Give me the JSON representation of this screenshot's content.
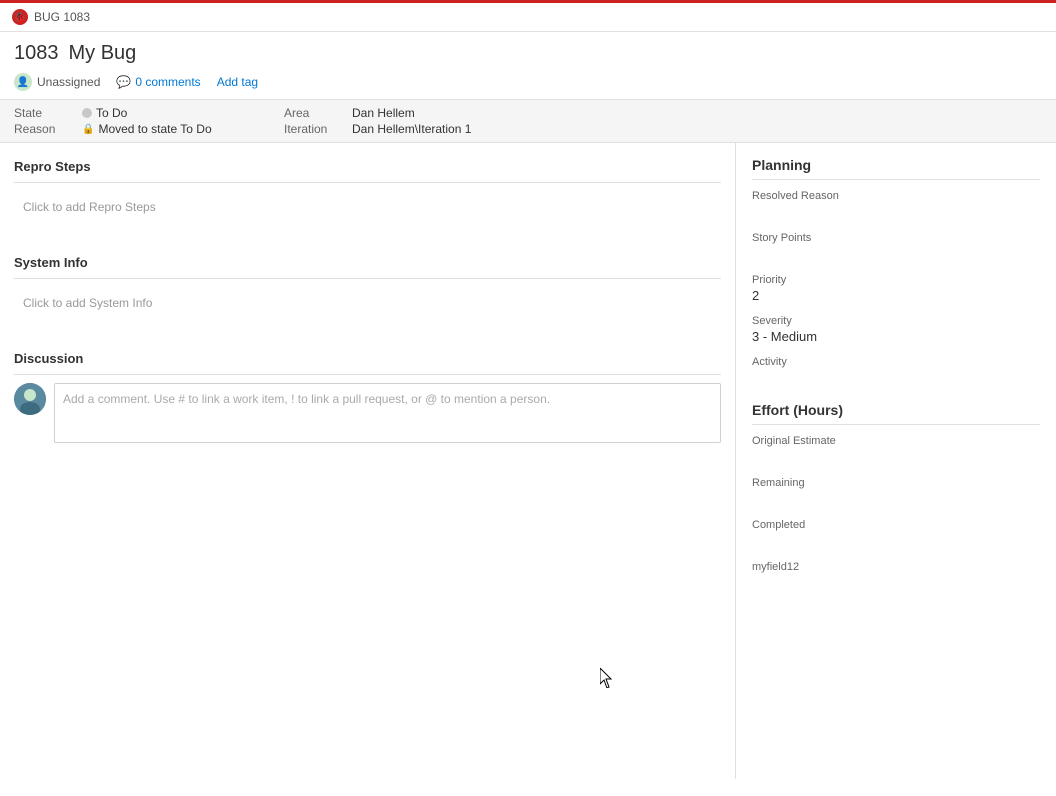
{
  "titleBar": {
    "bugIcon": "🐛",
    "bugLabel": "BUG 1083"
  },
  "header": {
    "workItemId": "1083",
    "workItemName": "My Bug",
    "assignedUser": "Unassigned",
    "commentsCount": "0 comments",
    "addTagLabel": "Add tag"
  },
  "fields": {
    "stateLabel": "State",
    "stateValue": "To Do",
    "areaLabel": "Area",
    "areaValue": "Dan Hellem",
    "reasonLabel": "Reason",
    "reasonValue": "Moved to state To Do",
    "iterationLabel": "Iteration",
    "iterationValue": "Dan Hellem\\Iteration 1"
  },
  "leftPanel": {
    "reproStepsTitle": "Repro Steps",
    "reproStepsPlaceholder": "Click to add Repro Steps",
    "systemInfoTitle": "System Info",
    "systemInfoPlaceholder": "Click to add System Info",
    "discussionTitle": "Discussion",
    "commentPlaceholder": "Add a comment. Use # to link a work item, ! to link a pull request, or @ to mention a person."
  },
  "rightPanel": {
    "planningTitle": "Planning",
    "resolvedReasonLabel": "Resolved Reason",
    "resolvedReasonValue": "",
    "storyPointsLabel": "Story Points",
    "storyPointsValue": "",
    "priorityLabel": "Priority",
    "priorityValue": "2",
    "severityLabel": "Severity",
    "severityValue": "3 - Medium",
    "activityLabel": "Activity",
    "activityValue": "",
    "effortTitle": "Effort (Hours)",
    "originalEstimateLabel": "Original Estimate",
    "originalEstimateValue": "",
    "remainingLabel": "Remaining",
    "remainingValue": "",
    "completedLabel": "Completed",
    "completedValue": "",
    "myfield12Label": "myfield12",
    "myfield12Value": ""
  }
}
